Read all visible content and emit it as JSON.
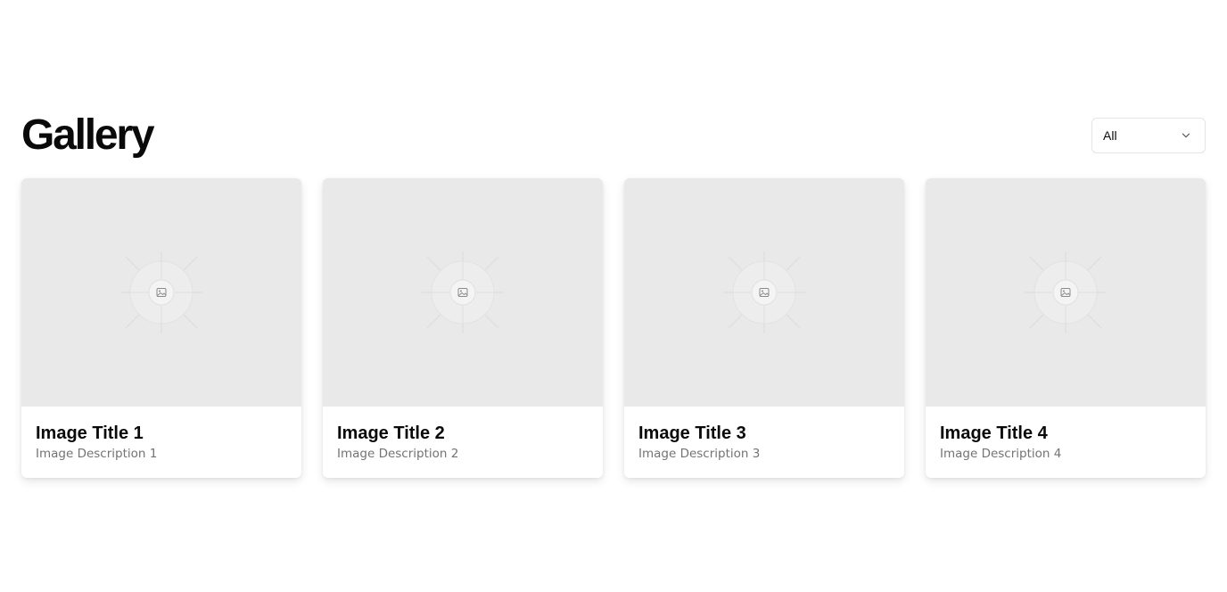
{
  "header": {
    "title": "Gallery"
  },
  "filter": {
    "selected": "All",
    "icon": "chevron-down-icon"
  },
  "gallery": {
    "items": [
      {
        "title": "Image Title 1",
        "description": "Image Description 1",
        "icon": "image-placeholder-icon"
      },
      {
        "title": "Image Title 2",
        "description": "Image Description 2",
        "icon": "image-placeholder-icon"
      },
      {
        "title": "Image Title 3",
        "description": "Image Description 3",
        "icon": "image-placeholder-icon"
      },
      {
        "title": "Image Title 4",
        "description": "Image Description 4",
        "icon": "image-placeholder-icon"
      }
    ]
  },
  "colors": {
    "placeholder_bg": "#e9e9e9",
    "title_text": "#0a0a0a",
    "muted_text": "#737373",
    "border": "#e5e5e5"
  }
}
